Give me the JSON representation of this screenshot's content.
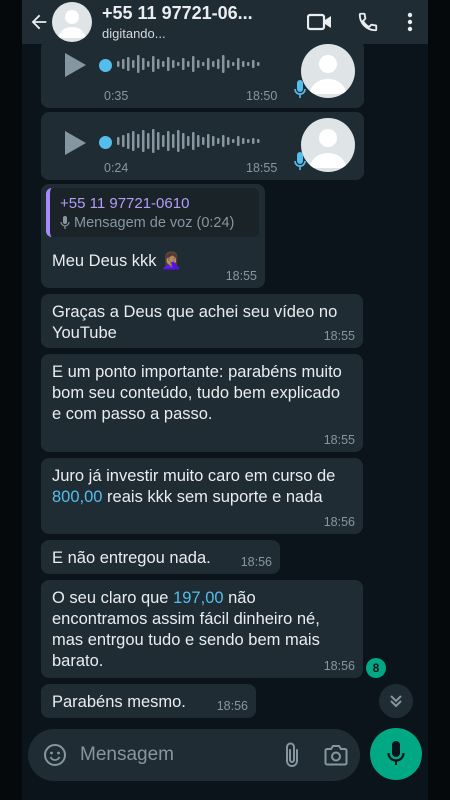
{
  "header": {
    "contact_name": "+55 11 97721-06...",
    "status": "digitando..."
  },
  "voice_messages": [
    {
      "duration": "0:35",
      "time": "18:50"
    },
    {
      "duration": "0:24",
      "time": "18:55"
    }
  ],
  "quoted_message": {
    "name": "+55 11 97721-0610",
    "preview": "Mensagem de voz (0:24)",
    "reply_text": "Meu Deus kkk 🤦🏽‍♀️",
    "time": "18:55"
  },
  "messages": [
    {
      "text": "Graças a Deus que achei seu vídeo no YouTube",
      "time": "18:55"
    },
    {
      "text": "E um ponto importante: parabéns muito bom seu conteúdo, tudo bem explicado e com passo a passo.",
      "time": "18:55"
    },
    {
      "text_before": "Juro já investir muito caro em curso de ",
      "link": "800,00",
      "text_after": " reais kkk sem suporte e nada",
      "time": "18:56"
    },
    {
      "text": "E não entregou nada.",
      "time": "18:56"
    },
    {
      "text_before": "O seu claro que ",
      "link": "197,00",
      "text_after": " não encontramos assim fácil dinheiro né, mas entrgou tudo e sendo bem mais barato.",
      "time": "18:56"
    },
    {
      "text": "Parabéns mesmo.",
      "time": "18:56"
    }
  ],
  "unread_count": "8",
  "composer": {
    "placeholder": "Mensagem"
  },
  "colors": {
    "header_bg": "#1f2c34",
    "chat_bg": "#0b141a",
    "bubble_bg": "#202c33",
    "accent": "#00a884",
    "link": "#53bdeb",
    "quote_name": "#b39dfa"
  },
  "icons": [
    "back-arrow-icon",
    "avatar-icon",
    "video-call-icon",
    "phone-icon",
    "more-vert-icon",
    "play-icon",
    "mic-icon",
    "emoji-icon",
    "attach-icon",
    "camera-icon",
    "chevron-double-down-icon"
  ]
}
